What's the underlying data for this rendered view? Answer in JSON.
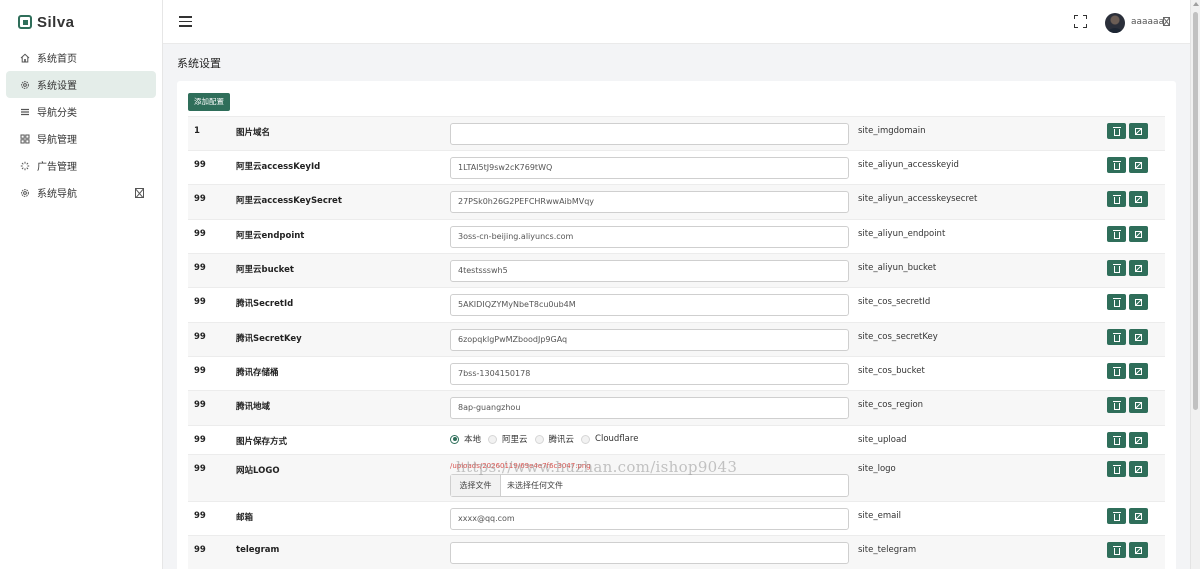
{
  "brand": {
    "name": "Silva"
  },
  "sidebar": {
    "items": [
      {
        "label": "系统首页",
        "icon": "home-icon",
        "active": false
      },
      {
        "label": "系统设置",
        "icon": "gear-icon",
        "active": true
      },
      {
        "label": "导航分类",
        "icon": "list-icon",
        "active": false
      },
      {
        "label": "导航管理",
        "icon": "grid-icon",
        "active": false
      },
      {
        "label": "广告管理",
        "icon": "spinner-icon",
        "active": false
      },
      {
        "label": "系统导航",
        "icon": "gear-icon",
        "active": false
      }
    ]
  },
  "header": {
    "user_name": "aaaaaa"
  },
  "page": {
    "title": "系统设置",
    "add_button": "添加配置"
  },
  "theme": {
    "accent": "#2f6e5a",
    "active_bg": "#e4ede9"
  },
  "rows": [
    {
      "sort": "1",
      "name": "图片域名",
      "value": "",
      "key": "site_imgdomain"
    },
    {
      "sort": "99",
      "name": "阿里云accessKeyId",
      "value": "1LTAI5tJ9sw2cK769tWQ",
      "key": "site_aliyun_accesskeyid"
    },
    {
      "sort": "99",
      "name": "阿里云accessKeySecret",
      "value": "27PSk0h26G2PEFCHRwwAibMVqy",
      "key": "site_aliyun_accesskeysecret"
    },
    {
      "sort": "99",
      "name": "阿里云endpoint",
      "value": "3oss-cn-beijing.aliyuncs.com",
      "key": "site_aliyun_endpoint"
    },
    {
      "sort": "99",
      "name": "阿里云bucket",
      "value": "4testssswh5",
      "key": "site_aliyun_bucket"
    },
    {
      "sort": "99",
      "name": "腾讯SecretId",
      "value": "5AKIDIQZYMyNbeT8cu0ub4M",
      "key": "site_cos_secretId"
    },
    {
      "sort": "99",
      "name": "腾讯SecretKey",
      "value": "6zopqklgPwMZboodJp9GAq",
      "key": "site_cos_secretKey"
    },
    {
      "sort": "99",
      "name": "腾讯存储桶",
      "value": "7bss-1304150178",
      "key": "site_cos_bucket"
    },
    {
      "sort": "99",
      "name": "腾讯地域",
      "value": "8ap-guangzhou",
      "key": "site_cos_region"
    },
    {
      "sort": "99",
      "name": "图片保存方式",
      "key": "site_upload",
      "options": [
        "本地",
        "阿里云",
        "腾讯云",
        "Cloudflare"
      ],
      "selected": "本地"
    },
    {
      "sort": "99",
      "name": "网站LOGO",
      "key": "site_logo",
      "path": "/uploads/20260119/69e4e7f6c3047.png",
      "choose_label": "选择文件",
      "file_label": "未选择任何文件"
    },
    {
      "sort": "99",
      "name": "邮箱",
      "value": "xxxx@qq.com",
      "key": "site_email"
    },
    {
      "sort": "99",
      "name": "telegram",
      "value": "",
      "key": "site_telegram"
    }
  ],
  "watermark": "https://www.huzhan.com/ishop9043"
}
